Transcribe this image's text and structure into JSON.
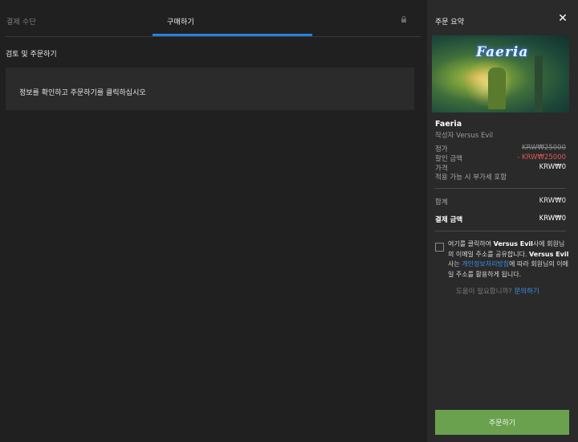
{
  "tabs": {
    "payment": "결제 수단",
    "purchase": "구매하기"
  },
  "left": {
    "section_title": "검토 및 주문하기",
    "info_text": "정보를 확인하고 주문하기를 클릭하십시오"
  },
  "summary": {
    "title": "주문 요약",
    "close_glyph": "✕",
    "cover_logo": "Faeria",
    "game_title": "Faeria",
    "publisher": "작성자  Versus Evil",
    "price_label": "정가",
    "price_value": "KRW₩25000",
    "discount_label": "할인 금액",
    "discount_value": "- KRW₩25000",
    "final_label": "가격",
    "final_value": "KRW₩0",
    "tax_note": "적용 가능 시 부가세 포함",
    "total_label": "합계",
    "total_value": "KRW₩0",
    "pay_label": "결제 금액",
    "pay_value": "KRW₩0"
  },
  "consent": {
    "part1": "여기를 클릭하여 ",
    "company1": "Versus Evil",
    "part2": "사에 회원님의 이메일 주소를 공유합니다. ",
    "company2": "Versus Evil",
    "part3": "사는 ",
    "policy_link": "개인정보처리방침",
    "part4": "에 따라 회원님의 이메일 주소를 활용하게 됩니다."
  },
  "help": {
    "text": "도움이 필요합니까? ",
    "link": "문의하기"
  },
  "order_button": "주문하기",
  "colors": {
    "accent_blue": "#2a7fe0",
    "discount_red": "#e0584f",
    "order_green": "#6aa14e",
    "link_blue": "#3b8eea"
  }
}
